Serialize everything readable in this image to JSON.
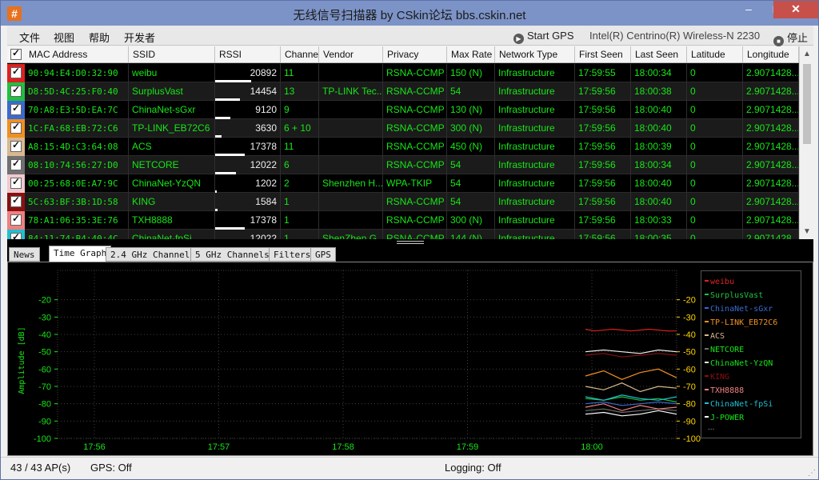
{
  "window": {
    "title": "无线信号扫描器 by CSkin论坛 bbs.cskin.net",
    "icon": "hash-icon",
    "min": "–",
    "max": "□",
    "close": "✕"
  },
  "menu": {
    "file": "文件",
    "view": "视图",
    "help": "帮助",
    "dev": "开发者",
    "start_gps": "Start GPS",
    "adapter": "Intel(R) Centrino(R) Wireless-N 2230",
    "stop": "停止"
  },
  "columns": [
    "MAC Address",
    "SSID",
    "RSSI",
    "Channel",
    "Vendor",
    "Privacy",
    "Max Rate",
    "Network Type",
    "First Seen",
    "Last Seen",
    "Latitude",
    "Longitude"
  ],
  "rows": [
    {
      "color": "#e02020",
      "mac": "90:94:E4:D0:32:90",
      "ssid": "weibu",
      "rssi": "20892",
      "rssi_pct": 0.55,
      "channel": "11",
      "vendor": "",
      "privacy": "RSNA-CCMP",
      "rate": "150 (N)",
      "type": "Infrastructure",
      "first": "17:59:55",
      "last": "18:00:34",
      "lat": "0",
      "lon": "2.9071428..."
    },
    {
      "color": "#20c040",
      "mac": "D8:5D:4C:25:F0:40",
      "ssid": "SurplusVast",
      "rssi": "14454",
      "rssi_pct": 0.38,
      "channel": "13",
      "vendor": "TP-LINK Tec...",
      "privacy": "RSNA-CCMP",
      "rate": "54",
      "type": "Infrastructure",
      "first": "17:59:56",
      "last": "18:00:38",
      "lat": "0",
      "lon": "2.9071428..."
    },
    {
      "color": "#3a6ad0",
      "mac": "70:A8:E3:5D:EA:7C",
      "ssid": "ChinaNet-sGxr",
      "rssi": "9120",
      "rssi_pct": 0.24,
      "channel": "9",
      "vendor": "",
      "privacy": "RSNA-CCMP",
      "rate": "130 (N)",
      "type": "Infrastructure",
      "first": "17:59:56",
      "last": "18:00:40",
      "lat": "0",
      "lon": "2.9071428..."
    },
    {
      "color": "#f09020",
      "mac": "1C:FA:68:EB:72:C6",
      "ssid": "TP-LINK_EB72C6",
      "rssi": "3630",
      "rssi_pct": 0.1,
      "channel": "6 + 10",
      "vendor": "",
      "privacy": "RSNA-CCMP",
      "rate": "300 (N)",
      "type": "Infrastructure",
      "first": "17:59:56",
      "last": "18:00:40",
      "lat": "0",
      "lon": "2.9071428..."
    },
    {
      "color": "#d8b890",
      "mac": "A8:15:4D:C3:64:08",
      "ssid": "ACS",
      "rssi": "17378",
      "rssi_pct": 0.46,
      "channel": "11",
      "vendor": "",
      "privacy": "RSNA-CCMP",
      "rate": "450 (N)",
      "type": "Infrastructure",
      "first": "17:59:56",
      "last": "18:00:39",
      "lat": "0",
      "lon": "2.9071428..."
    },
    {
      "color": "#707070",
      "mac": "08:10:74:56:27:D0",
      "ssid": "NETCORE",
      "rssi": "12022",
      "rssi_pct": 0.32,
      "channel": "6",
      "vendor": "",
      "privacy": "RSNA-CCMP",
      "rate": "54",
      "type": "Infrastructure",
      "first": "17:59:56",
      "last": "18:00:34",
      "lat": "0",
      "lon": "2.9071428..."
    },
    {
      "color": "#f0c8d0",
      "mac": "00:25:68:0E:A7:9C",
      "ssid": "ChinaNet-YzQN",
      "rssi": "1202",
      "rssi_pct": 0.03,
      "channel": "2",
      "vendor": "Shenzhen H...",
      "privacy": "WPA-TKIP",
      "rate": "54",
      "type": "Infrastructure",
      "first": "17:59:56",
      "last": "18:00:40",
      "lat": "0",
      "lon": "2.9071428..."
    },
    {
      "color": "#8a1010",
      "mac": "5C:63:BF:3B:1D:58",
      "ssid": "KING",
      "rssi": "1584",
      "rssi_pct": 0.04,
      "channel": "1",
      "vendor": "",
      "privacy": "RSNA-CCMP",
      "rate": "54",
      "type": "Infrastructure",
      "first": "17:59:56",
      "last": "18:00:40",
      "lat": "0",
      "lon": "2.9071428..."
    },
    {
      "color": "#f08080",
      "mac": "78:A1:06:35:3E:76",
      "ssid": "TXH8888",
      "rssi": "17378",
      "rssi_pct": 0.46,
      "channel": "1",
      "vendor": "",
      "privacy": "RSNA-CCMP",
      "rate": "300 (N)",
      "type": "Infrastructure",
      "first": "17:59:56",
      "last": "18:00:33",
      "lat": "0",
      "lon": "2.9071428..."
    },
    {
      "color": "#20c0d0",
      "mac": "84:11:74:B4:40:4C",
      "ssid": "ChinaNet-fpSi",
      "rssi": "12022",
      "rssi_pct": 0.32,
      "channel": "1",
      "vendor": "ShenZhen G...",
      "privacy": "RSNA-CCMP",
      "rate": "144 (N)",
      "type": "Infrastructure",
      "first": "17:59:56",
      "last": "18:00:35",
      "lat": "0",
      "lon": "2.9071428..."
    }
  ],
  "tabs": [
    "News",
    "Time Graph",
    "2.4 GHz Channels",
    "5 GHz Channels",
    "Filters",
    "GPS"
  ],
  "active_tab": "Time Graph",
  "chart_data": {
    "type": "line",
    "ylabel": "Amplitude [dB]",
    "ylim": [
      -100,
      -10
    ],
    "yticks": [
      -20,
      -30,
      -40,
      -50,
      -60,
      -70,
      -80,
      -90,
      -100
    ],
    "xticks": [
      "17:56",
      "17:57",
      "17:58",
      "17:59",
      "18:00"
    ],
    "colors": {
      "axis_left": "#16e616",
      "axis_right": "#ffd400",
      "grid": "#404040"
    },
    "series": [
      {
        "name": "weibu",
        "color": "#e02020",
        "x": [
          0,
          0.1,
          0.3,
          0.5,
          0.7,
          0.9,
          1
        ],
        "y": [
          -37,
          -38,
          -37,
          -38,
          -37,
          -38,
          -38
        ]
      },
      {
        "name": "SurplusVast",
        "color": "#20c040",
        "x": [
          0,
          0.2,
          0.4,
          0.6,
          0.8,
          1
        ],
        "y": [
          -77,
          -78,
          -76,
          -78,
          -77,
          -79
        ]
      },
      {
        "name": "ChinaNet-sGxr",
        "color": "#3a6ad0",
        "x": [
          0,
          0.2,
          0.4,
          0.6,
          0.8,
          1
        ],
        "y": [
          -80,
          -79,
          -81,
          -80,
          -79,
          -80
        ]
      },
      {
        "name": "TP-LINK_EB72C6",
        "color": "#f09020",
        "x": [
          0,
          0.2,
          0.4,
          0.6,
          0.8,
          1
        ],
        "y": [
          -64,
          -61,
          -66,
          -62,
          -60,
          -65
        ]
      },
      {
        "name": "ACS",
        "color": "#d8b890",
        "x": [
          0,
          0.2,
          0.4,
          0.6,
          0.8,
          1
        ],
        "y": [
          -70,
          -72,
          -68,
          -73,
          -70,
          -71
        ]
      },
      {
        "name": "NETCORE",
        "color": "#707070",
        "x": [
          0,
          0.2,
          0.4,
          0.6,
          0.8,
          1
        ],
        "y": [
          -84,
          -83,
          -85,
          -84,
          -83,
          -84
        ]
      },
      {
        "name": "ChinaNet-YzQN",
        "color": "#f0f0f0",
        "x": [
          0,
          0.2,
          0.4,
          0.6,
          0.8,
          1
        ],
        "y": [
          -50,
          -49,
          -50,
          -51,
          -49,
          -50
        ]
      },
      {
        "name": "KING",
        "color": "#8a1010",
        "x": [
          0,
          0.2,
          0.4,
          0.6,
          0.8,
          1
        ],
        "y": [
          -52,
          -51,
          -53,
          -52,
          -51,
          -52
        ]
      },
      {
        "name": "TXH8888",
        "color": "#f08080",
        "x": [
          0,
          0.2,
          0.4,
          0.6,
          0.8,
          1
        ],
        "y": [
          -82,
          -80,
          -84,
          -81,
          -83,
          -82
        ]
      },
      {
        "name": "ChinaNet-fpSi",
        "color": "#20c0d0",
        "x": [
          0,
          0.2,
          0.4,
          0.6,
          0.8,
          1
        ],
        "y": [
          -76,
          -78,
          -75,
          -77,
          -78,
          -76
        ]
      },
      {
        "name": "J-POWER",
        "color": "#ffffff",
        "x": [
          0,
          0.2,
          0.4,
          0.6,
          0.8,
          1
        ],
        "y": [
          -86,
          -85,
          -87,
          -86,
          -84,
          -86
        ]
      }
    ],
    "legend_more": "..."
  },
  "status": {
    "count": "43 / 43 AP(s)",
    "gps": "GPS: Off",
    "logging": "Logging: Off"
  }
}
